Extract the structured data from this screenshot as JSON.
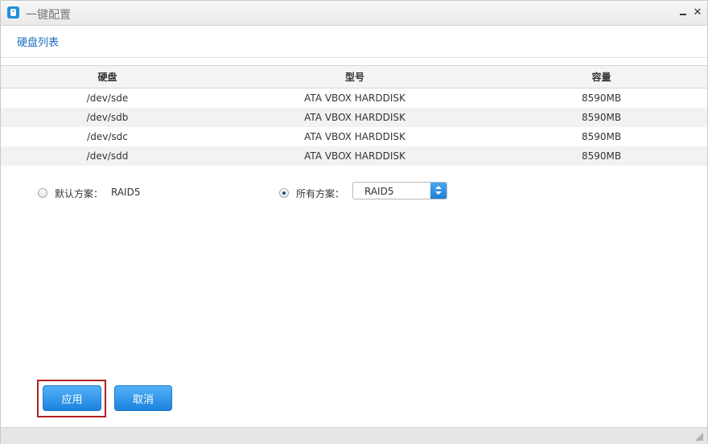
{
  "window": {
    "title": "一键配置",
    "icon": "app-drive-icon",
    "minimize_glyph": "",
    "close_glyph": "✕"
  },
  "section": {
    "title": "硬盘列表"
  },
  "table": {
    "headers": [
      "硬盘",
      "型号",
      "容量"
    ],
    "rows": [
      [
        "/dev/sde",
        "ATA VBOX HARDDISK",
        "8590MB"
      ],
      [
        "/dev/sdb",
        "ATA VBOX HARDDISK",
        "8590MB"
      ],
      [
        "/dev/sdc",
        "ATA VBOX HARDDISK",
        "8590MB"
      ],
      [
        "/dev/sdd",
        "ATA VBOX HARDDISK",
        "8590MB"
      ]
    ]
  },
  "options": {
    "default_label": "默认方案：",
    "default_value": "RAID5",
    "default_selected": false,
    "all_label": "所有方案：",
    "all_selected": true,
    "all_select_value": "RAID5"
  },
  "buttons": {
    "apply": "应用",
    "cancel": "取消"
  },
  "colors": {
    "accent": "#1b82e0",
    "focus_frame": "#b21f24",
    "section_title": "#1a6ec0"
  }
}
